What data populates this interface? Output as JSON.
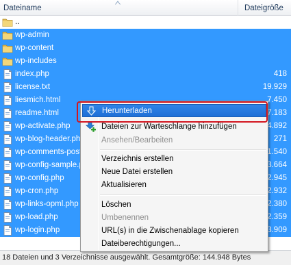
{
  "header": {
    "name_label": "Dateiname",
    "size_label": "Dateigröße"
  },
  "rows": [
    {
      "name": "..",
      "size": "",
      "icon": "folder-icon",
      "selected": false
    },
    {
      "name": "wp-admin",
      "size": "",
      "icon": "folder-icon",
      "selected": true
    },
    {
      "name": "wp-content",
      "size": "",
      "icon": "folder-icon",
      "selected": true
    },
    {
      "name": "wp-includes",
      "size": "",
      "icon": "folder-icon",
      "selected": true
    },
    {
      "name": "index.php",
      "size": "418",
      "icon": "file-icon",
      "selected": true
    },
    {
      "name": "license.txt",
      "size": "19.929",
      "icon": "file-icon",
      "selected": true
    },
    {
      "name": "liesmich.html",
      "size": "7.450",
      "icon": "file-icon",
      "selected": true
    },
    {
      "name": "readme.html",
      "size": "7.183",
      "icon": "file-icon",
      "selected": true
    },
    {
      "name": "wp-activate.php",
      "size": "4.892",
      "icon": "file-icon",
      "selected": true
    },
    {
      "name": "wp-blog-header.php",
      "size": "271",
      "icon": "file-icon",
      "selected": true
    },
    {
      "name": "wp-comments-post.php",
      "size": "1.540",
      "icon": "file-icon",
      "selected": true
    },
    {
      "name": "wp-config-sample.php",
      "size": "3.664",
      "icon": "file-icon",
      "selected": true
    },
    {
      "name": "wp-config.php",
      "size": "2.945",
      "icon": "file-icon",
      "selected": true
    },
    {
      "name": "wp-cron.php",
      "size": "2.932",
      "icon": "file-icon",
      "selected": true
    },
    {
      "name": "wp-links-opml.php",
      "size": "2.380",
      "icon": "file-icon",
      "selected": true
    },
    {
      "name": "wp-load.php",
      "size": "2.359",
      "icon": "file-icon",
      "selected": true
    },
    {
      "name": "wp-login.php",
      "size": "33.909",
      "icon": "file-icon",
      "selected": true
    }
  ],
  "context_menu": {
    "items": [
      {
        "label": "Herunterladen",
        "icon": "download-icon",
        "enabled": true,
        "highlighted": true
      },
      {
        "label": "Dateien zur Warteschlange hinzufügen",
        "icon": "add-to-queue-icon",
        "enabled": true
      },
      {
        "label": "Ansehen/Bearbeiten",
        "enabled": false
      },
      {
        "label": "Verzeichnis erstellen",
        "enabled": true
      },
      {
        "label": "Neue Datei erstellen",
        "enabled": true
      },
      {
        "label": "Aktualisieren",
        "enabled": true
      },
      {
        "label": "Löschen",
        "enabled": true
      },
      {
        "label": "Umbenennen",
        "enabled": false
      },
      {
        "label": "URL(s) in die Zwischenablage kopieren",
        "enabled": true
      },
      {
        "label": "Dateiberechtigungen...",
        "enabled": true
      }
    ]
  },
  "status_text": "18 Dateien und 3 Verzeichnisse ausgewählt. Gesamtgröße: 144.948 Bytes",
  "colors": {
    "selection": "#3399ff",
    "highlight": "#1f6fd6",
    "annotation": "#d3151f"
  }
}
